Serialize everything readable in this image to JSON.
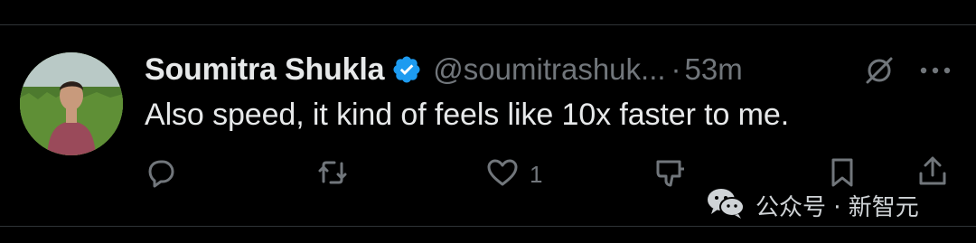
{
  "tweet": {
    "author_name": "Soumitra Shukla",
    "handle": "@soumitrashuk...",
    "separator": "·",
    "time": "53m",
    "text": "Also speed, it kind of feels like 10x faster to me."
  },
  "actions": {
    "reply_icon": "reply-icon",
    "retweet_icon": "retweet-icon",
    "like_icon": "heart-icon",
    "like_count": "1",
    "dislike_icon": "thumbs-down-icon",
    "bookmark_icon": "bookmark-icon",
    "share_icon": "share-icon"
  },
  "watermark": {
    "text": "公众号 · 新智元"
  },
  "colors": {
    "background": "#000000",
    "text_primary": "#e7e9ea",
    "text_secondary": "#71767b",
    "verified_blue": "#1d9bf0"
  }
}
